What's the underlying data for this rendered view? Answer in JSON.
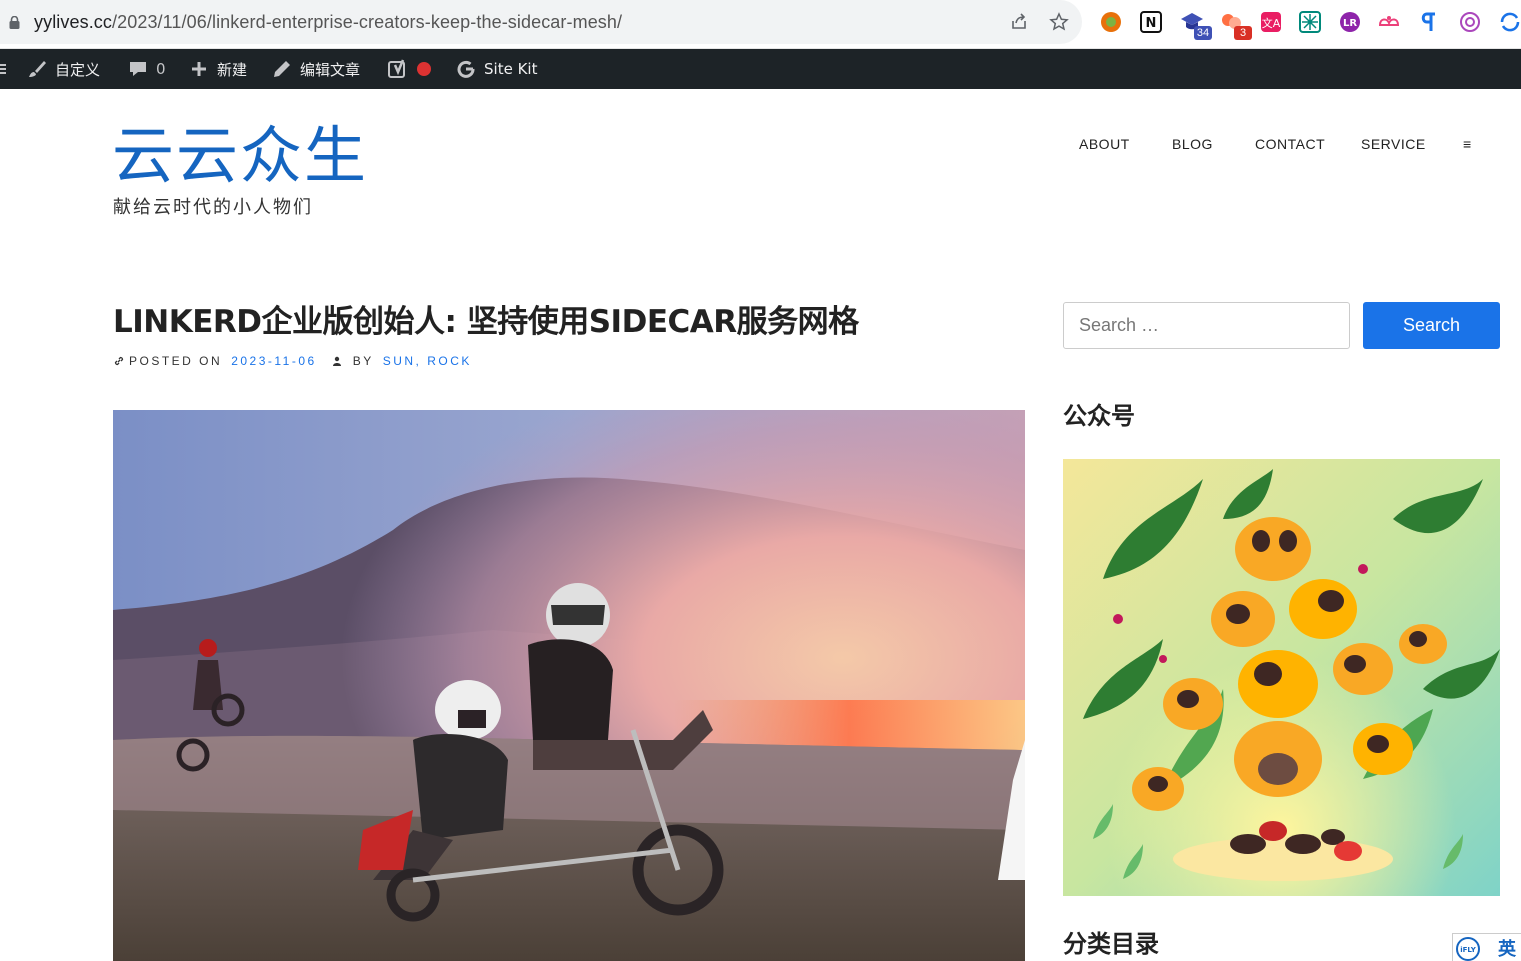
{
  "browser": {
    "url_domain": "yylives.cc",
    "url_path": "/2023/11/06/linkerd-enterprise-creators-keep-the-sidecar-mesh/",
    "extensions": [
      {
        "name": "circle-extension",
        "badge": ""
      },
      {
        "name": "notion-extension",
        "badge": ""
      },
      {
        "name": "graduation-cap-extension",
        "badge": "34"
      },
      {
        "name": "flower-extension",
        "badge": "3"
      },
      {
        "name": "translate-extension",
        "badge": ""
      },
      {
        "name": "grid-extension",
        "badge": ""
      },
      {
        "name": "purple-circle-extension",
        "badge": ""
      },
      {
        "name": "bow-extension",
        "badge": ""
      },
      {
        "name": "pilcrow-extension",
        "badge": ""
      },
      {
        "name": "openai-extension",
        "badge": ""
      },
      {
        "name": "sync-extension",
        "badge": ""
      }
    ]
  },
  "admin_bar": {
    "customize": "自定义",
    "comments_count": "0",
    "new": "新建",
    "edit_post": "编辑文章",
    "site_kit": "Site Kit"
  },
  "site": {
    "title": "云云众生",
    "tagline": "献给云时代的小人物们"
  },
  "nav": {
    "items": [
      "ABOUT",
      "BLOG",
      "CONTACT",
      "SERVICE"
    ],
    "menu_icon": "≡"
  },
  "post": {
    "title": "LINKERD企业版创始人: 坚持使用SIDECAR服务网格",
    "posted_on_label": "POSTED ON",
    "date": "2023-11-06",
    "by_label": "BY",
    "author": "SUN, ROCK"
  },
  "sidebar": {
    "search_placeholder": "Search …",
    "search_button": "Search",
    "wechat_title": "公众号",
    "categories_title": "分类目录"
  },
  "floating": {
    "ifly_label": "iFLY",
    "lang_label": "英"
  },
  "colors": {
    "accent": "#1a73e8",
    "site_title": "#1565c0",
    "admin_bar": "#1d2327"
  }
}
